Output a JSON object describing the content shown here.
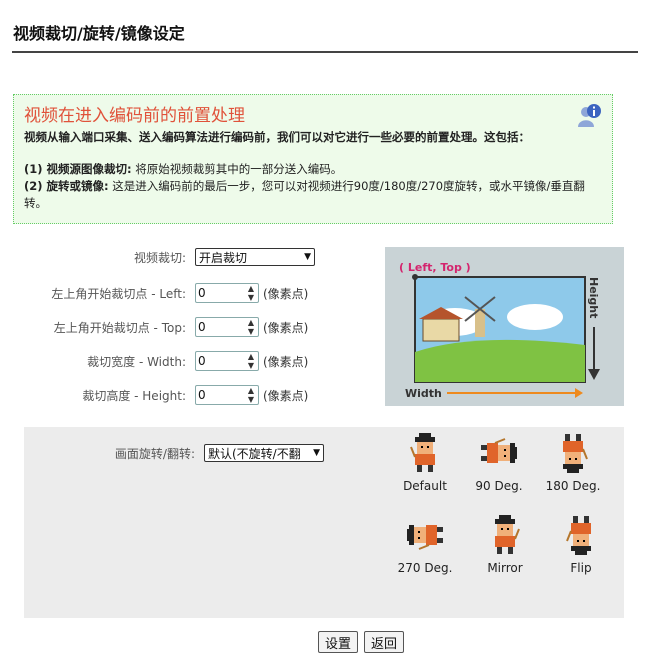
{
  "page": {
    "title": "视频裁切/旋转/镜像设定"
  },
  "info": {
    "heading": "视频在进入编码前的前置处理",
    "desc": "视频从输入端口采集、送入编码算法进行编码前，我们可以对它进行一些必要的前置处理。这包括：",
    "item1_label": "(1) 视频源图像裁切:",
    "item1_text": "将原始视频裁剪其中的一部分送入编码。",
    "item2_label": "(2) 旋转或镜像:",
    "item2_text": "这是进入编码前的最后一步，您可以对视频进行90度/180度/270度旋转，或水平镜像/垂直翻转。",
    "icon": "info-person-icon"
  },
  "crop": {
    "mode_label": "视频裁切:",
    "mode_value": "开启裁切",
    "left_label": "左上角开始裁切点 - Left:",
    "left_value": "0",
    "top_label": "左上角开始裁切点 - Top:",
    "top_value": "0",
    "width_label": "裁切宽度 - Width:",
    "width_value": "0",
    "height_label": "裁切高度 - Height:",
    "height_value": "0",
    "unit": "(像素点)",
    "illus_corner": "( Left, Top )",
    "illus_width": "Width",
    "illus_height": "Height",
    "colors": {
      "corner_text": "#d4256e",
      "arrow": "#ee8a1e",
      "sky": "#8ec9ea",
      "grass": "#7fc243"
    }
  },
  "rotate": {
    "label": "画面旋转/翻转:",
    "value": "默认(不旋转/不翻",
    "options": [
      {
        "caption": "Default"
      },
      {
        "caption": "90 Deg."
      },
      {
        "caption": "180 Deg."
      },
      {
        "caption": "270 Deg."
      },
      {
        "caption": "Mirror"
      },
      {
        "caption": "Flip"
      }
    ]
  },
  "buttons": {
    "save": "设置",
    "back": "返回"
  }
}
